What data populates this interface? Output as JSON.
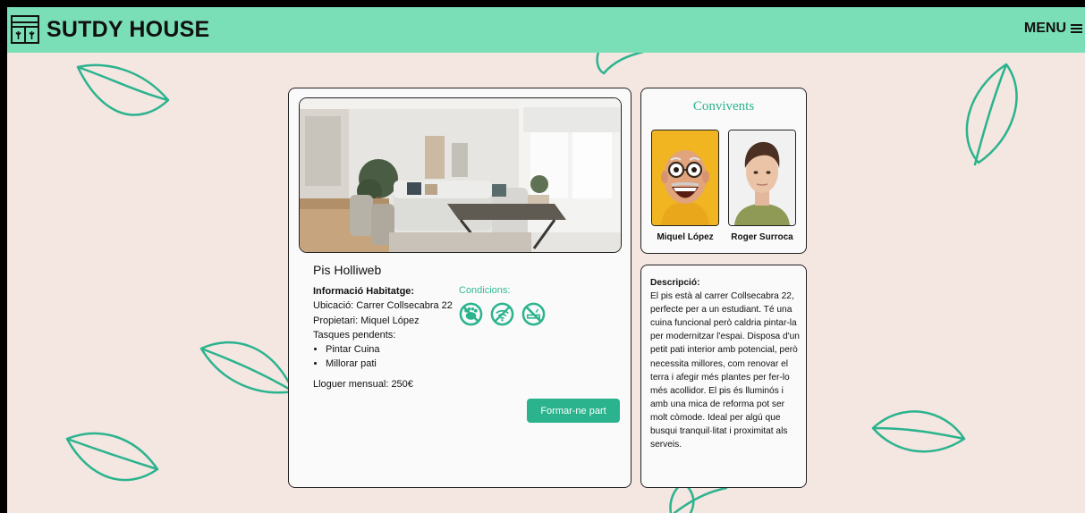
{
  "header": {
    "brand": "SUTDY HOUSE",
    "menu_label": "MENU"
  },
  "listing": {
    "name": "Pis Holliweb",
    "info_heading": "Informació Habitatge:",
    "location": "Ubicació: Carrer Collsecabra 22",
    "owner": "Propietari: Miquel López",
    "tasks_heading": "Tasques pendents:",
    "tasks": [
      "Pintar Cuina",
      "Millorar pati"
    ],
    "rent": "Lloguer mensual: 250€",
    "conditions_heading": "Condicions:",
    "condition_icons": [
      "no-pets-icon",
      "no-wifi-icon",
      "no-smoking-icon"
    ],
    "join_button": "Formar-ne part"
  },
  "roommates": {
    "title": "Convivents",
    "people": [
      {
        "name": "Miquel López"
      },
      {
        "name": "Roger Surroca"
      }
    ]
  },
  "description": {
    "heading": "Descripció:",
    "text": "El pis està al carrer Collsecabra 22, perfecte per a un estudiant. Té una cuina funcional però caldria pintar-la per modernitzar l'espai. Disposa d'un petit pati interior amb potencial, però necessita millores, com renovar el terra i afegir més plantes per fer-lo més acollidor. El pis és lluminós i amb una mica de reforma pot ser molt còmode. Ideal per algú que busqui tranquil·litat i proximitat als serveis."
  },
  "colors": {
    "header": "#7adfb7",
    "accent": "#2bb38e",
    "background": "#f4e6e1"
  }
}
